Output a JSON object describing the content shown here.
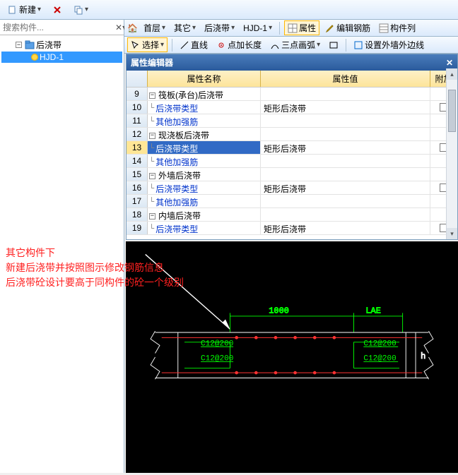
{
  "toolbar": {
    "new_btn": "新建",
    "nav": {
      "layer": "首层",
      "other": "其它",
      "hjd_cat": "后浇带",
      "hjd_item": "HJD-1"
    },
    "prop_btn": "属性",
    "edit_rebar": "编辑钢筋",
    "component_list": "构件列",
    "select": "选择",
    "line": "直线",
    "point_len": "点加长度",
    "arc3": "三点画弧",
    "outer_wall": "设置外墙外边线"
  },
  "search": {
    "placeholder": "搜索构件..."
  },
  "tree": {
    "root": "后浇带",
    "child": "HJD-1"
  },
  "prop": {
    "title": "属性编辑器",
    "col_name": "属性名称",
    "col_value": "属性值",
    "col_extra": "附加",
    "rows": [
      {
        "n": "9",
        "group": true,
        "name": "筏板(承台)后浇带"
      },
      {
        "n": "10",
        "name": "后浇带类型",
        "val": "矩形后浇带",
        "cb": true
      },
      {
        "n": "11",
        "name": "其他加强筋"
      },
      {
        "n": "12",
        "group": true,
        "name": "现浇板后浇带"
      },
      {
        "n": "13",
        "name": "后浇带类型",
        "val": "矩形后浇带",
        "cb": true,
        "sel": true
      },
      {
        "n": "14",
        "name": "其他加强筋"
      },
      {
        "n": "15",
        "group": true,
        "name": "外墙后浇带"
      },
      {
        "n": "16",
        "name": "后浇带类型",
        "val": "矩形后浇带",
        "cb": true
      },
      {
        "n": "17",
        "name": "其他加强筋"
      },
      {
        "n": "18",
        "group": true,
        "name": "内墙后浇带"
      },
      {
        "n": "19",
        "name": "后浇带类型",
        "val": "矩形后浇带",
        "cb": true
      }
    ]
  },
  "annot": {
    "l1": "其它构件下",
    "l2": "新建后浇带并按照图示修改钢筋信息",
    "l3": "后浇带砼设计要高于同构件的砼一个级别"
  },
  "cad": {
    "dim": "1000",
    "lae": "LAE",
    "h": "h",
    "c1": "C12@200",
    "c2": "C12@200",
    "c3": "C12@200",
    "c4": "C12@200"
  }
}
